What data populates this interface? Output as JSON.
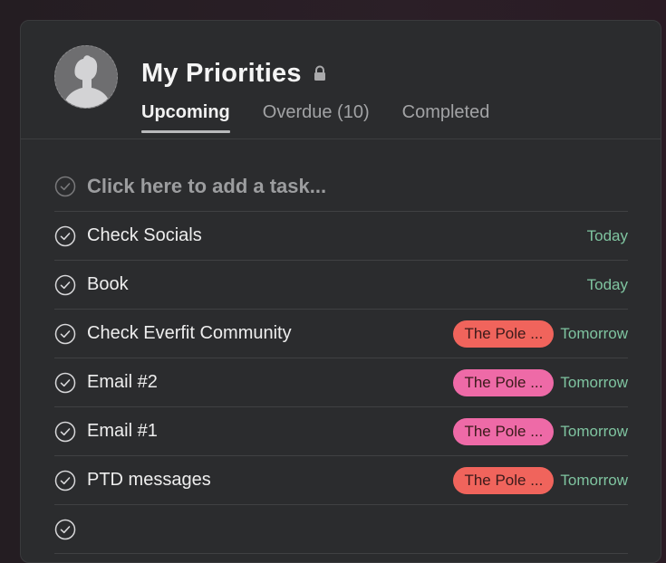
{
  "header": {
    "title": "My Priorities",
    "lock_icon": "lock-icon",
    "tabs": [
      {
        "label": "Upcoming",
        "active": true
      },
      {
        "label": "Overdue (10)",
        "active": false
      },
      {
        "label": "Completed",
        "active": false
      }
    ]
  },
  "add_task": {
    "placeholder": "Click here to add a task...",
    "icon": "check-circle-icon"
  },
  "tasks": [
    {
      "name": "Check Socials",
      "tag": "",
      "tag_color": "",
      "due": "Today"
    },
    {
      "name": "Book",
      "tag": "",
      "tag_color": "",
      "due": "Today"
    },
    {
      "name": "Check Everfit Community",
      "tag": "The Pole ...",
      "tag_color": "#f0645c",
      "due": "Tomorrow"
    },
    {
      "name": "Email #2",
      "tag": "The Pole ...",
      "tag_color": "#ee6aa7",
      "due": "Tomorrow"
    },
    {
      "name": "Email #1",
      "tag": "The Pole ...",
      "tag_color": "#ee6aa7",
      "due": "Tomorrow"
    },
    {
      "name": "PTD messages",
      "tag": "The Pole ...",
      "tag_color": "#f0645c",
      "due": "Tomorrow"
    }
  ],
  "colors": {
    "background": "#2b2c2e",
    "due_text": "#7fc4a0",
    "tag_red": "#f0645c",
    "tag_pink": "#ee6aa7"
  }
}
